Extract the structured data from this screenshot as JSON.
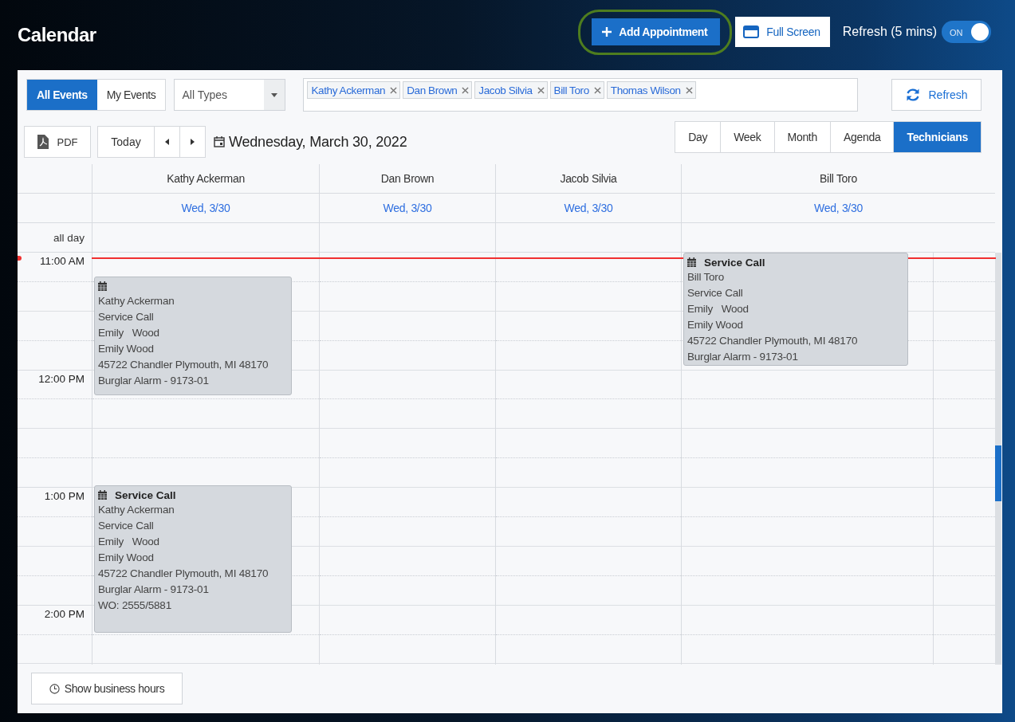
{
  "header": {
    "title": "Calendar",
    "add_button": "Add Appointment",
    "fullscreen_button": "Full Screen",
    "refresh_label": "Refresh (5 mins)",
    "auto_refresh": {
      "label": "ON",
      "on": true
    }
  },
  "filters": {
    "event_tabs": [
      {
        "label": "All Events",
        "selected": true
      },
      {
        "label": "My Events",
        "selected": false
      }
    ],
    "type_select": "All Types",
    "technicians": [
      "Kathy Ackerman",
      "Dan Brown",
      "Jacob Silvia",
      "Bill Toro",
      "Thomas Wilson"
    ],
    "refresh_button": "Refresh"
  },
  "nav": {
    "pdf_button": "PDF",
    "today_button": "Today",
    "date": "Wednesday, March 30, 2022",
    "views": [
      {
        "label": "Day",
        "selected": false
      },
      {
        "label": "Week",
        "selected": false
      },
      {
        "label": "Month",
        "selected": false
      },
      {
        "label": "Agenda",
        "selected": false
      },
      {
        "label": "Technicians",
        "selected": true
      }
    ]
  },
  "grid": {
    "all_day_label": "all day",
    "times": [
      "11:00 AM",
      "12:00 PM",
      "1:00 PM",
      "2:00 PM"
    ],
    "columns": [
      {
        "name": "Kathy Ackerman",
        "date": "Wed, 3/30",
        "events": [
          {
            "lines": [
              "Kathy Ackerman",
              "Service Call",
              "Emily   Wood",
              "Emily Wood",
              "45722 Chandler Plymouth, MI 48170",
              "Burglar Alarm - 9173-01"
            ]
          },
          {
            "title": "Service Call",
            "lines": [
              "Kathy Ackerman",
              "Service Call",
              "Emily   Wood",
              "Emily Wood",
              "45722 Chandler Plymouth, MI 48170",
              "Burglar Alarm - 9173-01",
              "WO: 2555/5881"
            ]
          }
        ]
      },
      {
        "name": "Dan Brown",
        "date": "Wed, 3/30"
      },
      {
        "name": "Jacob Silvia",
        "date": "Wed, 3/30"
      },
      {
        "name": "Bill Toro",
        "date": "Wed, 3/30",
        "events": [
          {
            "title": "Service Call",
            "lines": [
              "Bill Toro",
              "Service Call",
              "Emily   Wood",
              "Emily Wood",
              "45722 Chandler Plymouth, MI 48170",
              "Burglar Alarm - 9173-01"
            ]
          }
        ]
      }
    ]
  },
  "footer_button": "Show business hours"
}
